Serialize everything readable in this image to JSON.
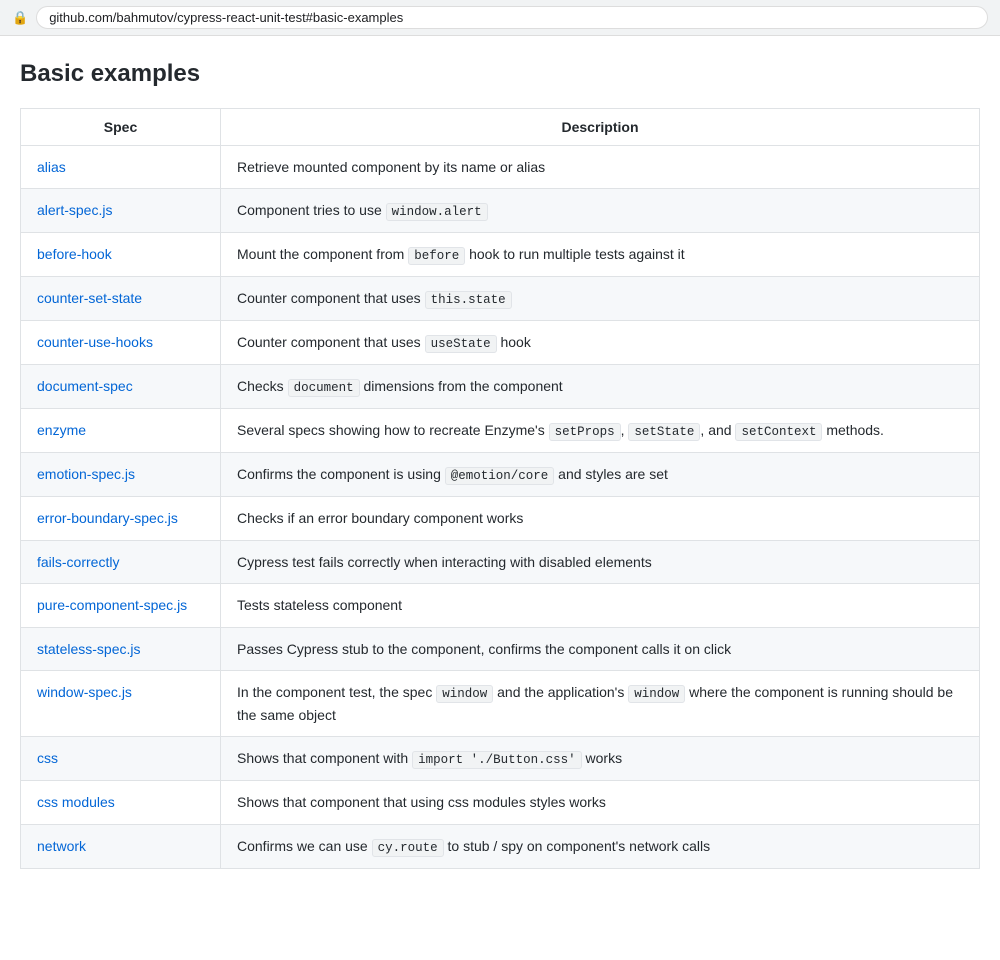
{
  "browser": {
    "url": "github.com/bahmutov/cypress-react-unit-test#basic-examples"
  },
  "page": {
    "title": "Basic examples"
  },
  "table": {
    "headers": {
      "spec": "Spec",
      "description": "Description"
    },
    "rows": [
      {
        "spec": "alias",
        "spec_href": "#",
        "description_parts": [
          {
            "type": "text",
            "content": "Retrieve mounted component by its name or alias"
          }
        ]
      },
      {
        "spec": "alert-spec.js",
        "spec_href": "#",
        "description_parts": [
          {
            "type": "text",
            "content": "Component tries to use "
          },
          {
            "type": "code",
            "content": "window.alert"
          }
        ]
      },
      {
        "spec": "before-hook",
        "spec_href": "#",
        "description_parts": [
          {
            "type": "text",
            "content": "Mount the component from "
          },
          {
            "type": "code",
            "content": "before"
          },
          {
            "type": "text",
            "content": " hook to run multiple tests against it"
          }
        ]
      },
      {
        "spec": "counter-set-state",
        "spec_href": "#",
        "description_parts": [
          {
            "type": "text",
            "content": "Counter component that uses "
          },
          {
            "type": "code",
            "content": "this.state"
          }
        ]
      },
      {
        "spec": "counter-use-hooks",
        "spec_href": "#",
        "description_parts": [
          {
            "type": "text",
            "content": "Counter component that uses "
          },
          {
            "type": "code",
            "content": "useState"
          },
          {
            "type": "text",
            "content": " hook"
          }
        ]
      },
      {
        "spec": "document-spec",
        "spec_href": "#",
        "description_parts": [
          {
            "type": "text",
            "content": "Checks "
          },
          {
            "type": "code",
            "content": "document"
          },
          {
            "type": "text",
            "content": " dimensions from the component"
          }
        ]
      },
      {
        "spec": "enzyme",
        "spec_href": "#",
        "description_parts": [
          {
            "type": "text",
            "content": "Several specs showing how to recreate Enzyme's "
          },
          {
            "type": "code",
            "content": "setProps"
          },
          {
            "type": "text",
            "content": ", "
          },
          {
            "type": "code",
            "content": "setState"
          },
          {
            "type": "text",
            "content": ", and "
          },
          {
            "type": "code",
            "content": "setContext"
          },
          {
            "type": "text",
            "content": " methods."
          }
        ]
      },
      {
        "spec": "emotion-spec.js",
        "spec_href": "#",
        "description_parts": [
          {
            "type": "text",
            "content": "Confirms the component is using "
          },
          {
            "type": "code",
            "content": "@emotion/core"
          },
          {
            "type": "text",
            "content": " and styles are set"
          }
        ]
      },
      {
        "spec": "error-boundary-spec.js",
        "spec_href": "#",
        "description_parts": [
          {
            "type": "text",
            "content": "Checks if an error boundary component works"
          }
        ]
      },
      {
        "spec": "fails-correctly",
        "spec_href": "#",
        "description_parts": [
          {
            "type": "text",
            "content": "Cypress test fails correctly when interacting with disabled elements"
          }
        ]
      },
      {
        "spec": "pure-component-spec.js",
        "spec_href": "#",
        "description_parts": [
          {
            "type": "text",
            "content": "Tests stateless component"
          }
        ]
      },
      {
        "spec": "stateless-spec.js",
        "spec_href": "#",
        "description_parts": [
          {
            "type": "text",
            "content": "Passes Cypress stub to the component, confirms the component calls it on click"
          }
        ]
      },
      {
        "spec": "window-spec.js",
        "spec_href": "#",
        "description_parts": [
          {
            "type": "text",
            "content": "In the component test, the spec "
          },
          {
            "type": "code",
            "content": "window"
          },
          {
            "type": "text",
            "content": " and the application's "
          },
          {
            "type": "code",
            "content": "window"
          },
          {
            "type": "text",
            "content": " where the component is running should be the same object"
          }
        ]
      },
      {
        "spec": "css",
        "spec_href": "#",
        "description_parts": [
          {
            "type": "text",
            "content": "Shows that component with "
          },
          {
            "type": "code",
            "content": "import './Button.css'"
          },
          {
            "type": "text",
            "content": " works"
          }
        ]
      },
      {
        "spec": "css modules",
        "spec_href": "#",
        "description_parts": [
          {
            "type": "text",
            "content": "Shows that component that using css modules styles works"
          }
        ]
      },
      {
        "spec": "network",
        "spec_href": "#",
        "description_parts": [
          {
            "type": "text",
            "content": "Confirms we can use "
          },
          {
            "type": "code",
            "content": "cy.route"
          },
          {
            "type": "text",
            "content": " to stub / spy on component's network calls"
          }
        ]
      }
    ]
  }
}
